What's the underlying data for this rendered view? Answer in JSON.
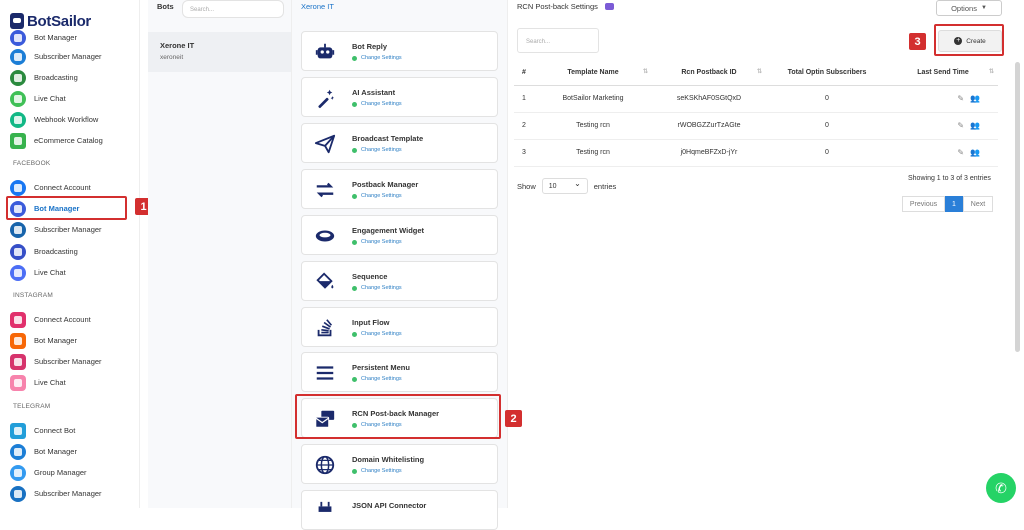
{
  "app": {
    "name": "BotSailor"
  },
  "sidebar": {
    "items": [
      {
        "label": "Bot Manager",
        "color": "#3b5bdb"
      },
      {
        "label": "Subscriber Manager",
        "color": "#1c7ed6"
      },
      {
        "label": "Broadcasting",
        "color": "#2b8a3e"
      },
      {
        "label": "Live Chat",
        "color": "#40c057"
      },
      {
        "label": "Webhook Workflow",
        "color": "#12b886"
      },
      {
        "label": "eCommerce Catalog",
        "color": "#37b24d"
      }
    ],
    "facebook": {
      "heading": "FACEBOOK",
      "items": [
        {
          "label": "Connect Account",
          "color": "#1877f2"
        },
        {
          "label": "Bot Manager",
          "color": "#3b5bdb"
        },
        {
          "label": "Subscriber Manager",
          "color": "#1864ab"
        },
        {
          "label": "Broadcasting",
          "color": "#364fc7"
        },
        {
          "label": "Live Chat",
          "color": "#4c6ef5"
        }
      ]
    },
    "instagram": {
      "heading": "INSTAGRAM",
      "items": [
        {
          "label": "Connect Account",
          "color": "#e1306c"
        },
        {
          "label": "Bot Manager",
          "color": "#f76707"
        },
        {
          "label": "Subscriber Manager",
          "color": "#d6336c"
        },
        {
          "label": "Live Chat",
          "color": "#f783ac"
        }
      ]
    },
    "telegram": {
      "heading": "TELEGRAM",
      "items": [
        {
          "label": "Connect Bot",
          "color": "#229ed9"
        },
        {
          "label": "Bot Manager",
          "color": "#1c7ed6"
        },
        {
          "label": "Group Manager",
          "color": "#339af0"
        },
        {
          "label": "Subscriber Manager",
          "color": "#1971c2"
        }
      ]
    }
  },
  "bots_panel": {
    "heading": "Bots",
    "search_placeholder": "Search...",
    "bot": {
      "name": "Xerone IT",
      "handle": "xeroneit"
    }
  },
  "settings_panel": {
    "heading": "Xerone IT",
    "change_label": "Change Settings",
    "cards": [
      {
        "title": "Bot Reply",
        "icon": "robot-icon"
      },
      {
        "title": "AI Assistant",
        "icon": "magic-wand-icon"
      },
      {
        "title": "Broadcast Template",
        "icon": "paper-plane-icon"
      },
      {
        "title": "Postback Manager",
        "icon": "exchange-arrows-icon"
      },
      {
        "title": "Engagement Widget",
        "icon": "ring-icon"
      },
      {
        "title": "Sequence",
        "icon": "paint-bucket-icon"
      },
      {
        "title": "Input Flow",
        "icon": "stack-overflow-icon"
      },
      {
        "title": "Persistent Menu",
        "icon": "menu-bars-icon"
      },
      {
        "title": "RCN Post-back Manager",
        "icon": "mail-bulk-icon"
      },
      {
        "title": "Domain Whitelisting",
        "icon": "globe-icon"
      },
      {
        "title": "JSON API Connector",
        "icon": "plug-icon"
      }
    ]
  },
  "main": {
    "title": "RCN Post-back Settings",
    "options_label": "Options",
    "search_placeholder": "Search...",
    "create_label": "Create",
    "columns": [
      "#",
      "Template Name",
      "Rcn Postback ID",
      "Total Optin Subscribers",
      "Last Send Time"
    ],
    "rows": [
      {
        "num": "1",
        "name": "BotSailor Marketing",
        "id": "seKSKhAF0SGtQxD",
        "subs": "0"
      },
      {
        "num": "2",
        "name": "Testing rcn",
        "id": "rWOBGZZurTzAGte",
        "subs": "0"
      },
      {
        "num": "3",
        "name": "Testing rcn",
        "id": "j0HqmeBFZxD-jYr",
        "subs": "0"
      }
    ],
    "show_label": "Show",
    "entries_value": "10",
    "entries_label": "entries",
    "showing_text": "Showing 1 to 3 of 3 entries",
    "pagination": {
      "previous": "Previous",
      "current": "1",
      "next": "Next"
    }
  },
  "annotations": [
    "1",
    "2",
    "3"
  ],
  "colors": {
    "accent": "#1a73c8",
    "highlight": "#d32f2f",
    "whatsapp": "#25d366"
  }
}
